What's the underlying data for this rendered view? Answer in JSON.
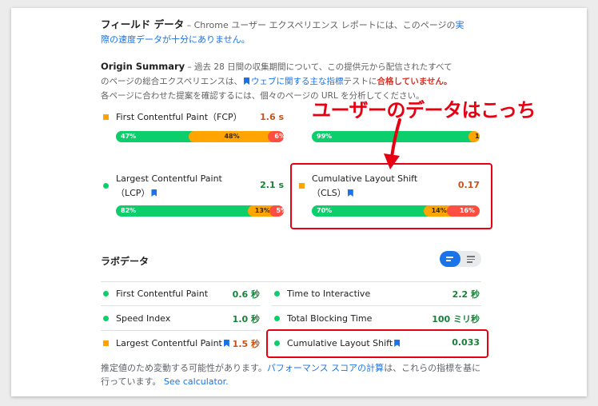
{
  "field": {
    "title": "フィールド データ",
    "desc_pre": " – Chrome ユーザー エクスペリエンス レポートには、このページの",
    "desc_link": "実際の速度データが十分にありません。"
  },
  "origin": {
    "title": "Origin Summary",
    "text1": " – 過去 28 日間の収集期間について、この提供元から配信されたすべてのページの総合エクスペリエンスは、",
    "link": "ウェブに関する主な指標",
    "text2": "テストに",
    "status": "合格していません。",
    "text3": " 各ページに合わせた提案を確認するには、個々のページの URL を分析してください。"
  },
  "callout": "ユーザーのデータはこっち",
  "origin_metrics": {
    "fcp": {
      "name": "First Contentful Paint（FCP）",
      "value": "1.6 s",
      "good": "47%",
      "ni": "48%",
      "poor": "6%",
      "good_pct": 47,
      "ni_pct": 48,
      "poor_pct": 6
    },
    "fid": {
      "good": "99%",
      "ni": "1%",
      "good_pct": 99,
      "ni_pct": 1
    },
    "lcp": {
      "name1": "Largest Contentful Paint",
      "name2": "（LCP）",
      "value": "2.1 s",
      "good": "82%",
      "ni": "13%",
      "poor": "5%",
      "good_pct": 82,
      "ni_pct": 13,
      "poor_pct": 5
    },
    "cls": {
      "name1": "Cumulative Layout Shift",
      "name2": "（CLS）",
      "value": "0.17",
      "good": "70%",
      "ni": "14%",
      "poor": "16%",
      "good_pct": 70,
      "ni_pct": 14,
      "poor_pct": 16
    }
  },
  "lab": {
    "title": "ラボデータ",
    "metrics": [
      {
        "name": "First Contentful Paint",
        "value": "0.6 秒"
      },
      {
        "name": "Time to Interactive",
        "value": "2.2 秒"
      },
      {
        "name": "Speed Index",
        "value": "1.0 秒"
      },
      {
        "name": "Total Blocking Time",
        "value": "100 ミリ秒"
      },
      {
        "name": "Largest Contentful Paint",
        "value": "1.5 秒"
      },
      {
        "name": "Cumulative Layout Shift",
        "value": "0.033"
      }
    ]
  },
  "footer": {
    "pre": "推定値のため変動する可能性があります。",
    "link": "パフォーマンス スコアの計算",
    "post": "は、これらの指標を基に行っています。",
    "calc": "See calculator."
  },
  "colors": {
    "good": "#0cce6b",
    "average": "#ffa400",
    "poor": "#ff4e42",
    "accent": "#1a73e8",
    "highlight": "#e60012"
  }
}
